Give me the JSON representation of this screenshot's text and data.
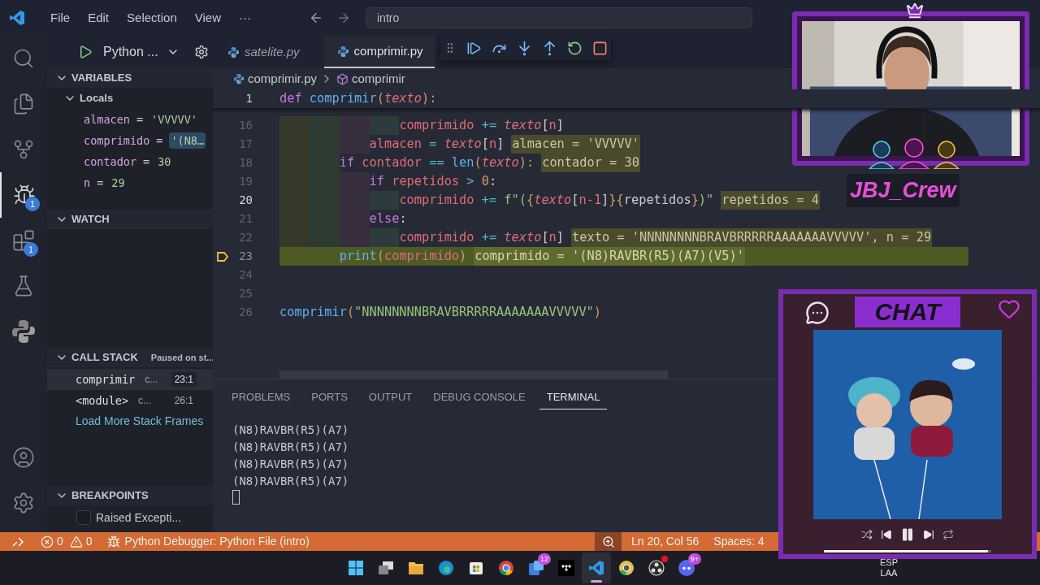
{
  "menu": [
    "File",
    "Edit",
    "Selection",
    "View",
    "···"
  ],
  "search": {
    "value": "intro"
  },
  "activity_bar": [
    {
      "kind": "search",
      "selected": false
    },
    {
      "kind": "files",
      "selected": false
    },
    {
      "kind": "source-control",
      "selected": false
    },
    {
      "kind": "debug",
      "selected": true,
      "badge": "1"
    },
    {
      "kind": "extensions",
      "selected": false,
      "badge": "1"
    },
    {
      "kind": "testing",
      "selected": false
    },
    {
      "kind": "python",
      "selected": false
    }
  ],
  "activity_bottom": [
    {
      "kind": "account"
    },
    {
      "kind": "settings"
    }
  ],
  "run_bar": {
    "config": "Python ..."
  },
  "variables": {
    "title": "VARIABLES",
    "expanded": true,
    "scopes": [
      {
        "label": "Locals",
        "expanded": true,
        "children": [
          {
            "name": "almacen",
            "op": "=",
            "value": "'VVVVV'",
            "selected": false
          },
          {
            "name": "comprimido",
            "op": "=",
            "value": "'(N8…",
            "selected": true
          },
          {
            "name": "contador",
            "op": "=",
            "value": "30",
            "selected": false
          },
          {
            "name": "n",
            "op": "=",
            "value": "29",
            "selected": false
          }
        ]
      }
    ]
  },
  "watch": {
    "title": "WATCH",
    "expanded": true
  },
  "call_stack": {
    "title": "CALL STACK",
    "expanded": true,
    "status": "Paused on st...",
    "frames": [
      {
        "name": "comprimir",
        "file": "c...",
        "position": "23:1",
        "selected": true
      },
      {
        "name": "<module>",
        "file": "c...",
        "position": "26:1",
        "selected": false
      }
    ],
    "load_more": "Load More Stack Frames"
  },
  "breakpoints": {
    "title": "BREAKPOINTS",
    "expanded": true,
    "items": [
      {
        "label": "Raised Excepti...",
        "checked": false
      }
    ]
  },
  "tabs": [
    {
      "label": "satelite.py",
      "selected": false,
      "preview": true
    },
    {
      "label": "comprimir.py",
      "selected": true,
      "preview": false
    }
  ],
  "debug_toolbar": [
    {
      "kind": "continue"
    },
    {
      "kind": "step-over"
    },
    {
      "kind": "step-into"
    },
    {
      "kind": "step-out"
    },
    {
      "kind": "restart"
    },
    {
      "kind": "stop"
    }
  ],
  "breadcrumbs": [
    {
      "label": "comprimir.py",
      "kind": "file"
    },
    {
      "label": "comprimir",
      "kind": "symbol"
    }
  ],
  "sticky_line": {
    "number": "1",
    "tokens": [
      {
        "t": "def ",
        "kind": "kw"
      },
      {
        "t": "comprimir",
        "kind": "fn"
      },
      {
        "t": "(",
        "kind": "punc"
      },
      {
        "t": "texto",
        "kind": "param"
      },
      {
        "t": "):",
        "kind": "punc"
      }
    ]
  },
  "code": [
    {
      "number": "16",
      "current": false,
      "tokens": [
        {
          "t": "                comprimido ",
          "kind": "var"
        },
        {
          "t": "+= ",
          "kind": "op"
        },
        {
          "t": "texto",
          "kind": "param"
        },
        {
          "t": "[",
          "kind": "plain"
        },
        {
          "t": "n",
          "kind": "var"
        },
        {
          "t": "]",
          "kind": "plain"
        }
      ]
    },
    {
      "number": "17",
      "current": false,
      "tokens": [
        {
          "t": "            almacen ",
          "kind": "var"
        },
        {
          "t": "= ",
          "kind": "op"
        },
        {
          "t": "texto",
          "kind": "param"
        },
        {
          "t": "[",
          "kind": "plain"
        },
        {
          "t": "n",
          "kind": "var"
        },
        {
          "t": "]",
          "kind": "plain"
        }
      ],
      "inline_value": "almacen = 'VVVVV'"
    },
    {
      "number": "18",
      "current": false,
      "tokens": [
        {
          "t": "        if ",
          "kind": "kw"
        },
        {
          "t": "contador ",
          "kind": "var"
        },
        {
          "t": "== ",
          "kind": "op"
        },
        {
          "t": "len",
          "kind": "fn"
        },
        {
          "t": "(",
          "kind": "punc"
        },
        {
          "t": "texto",
          "kind": "param"
        },
        {
          "t": "):",
          "kind": "punc"
        }
      ],
      "inline_value": "contador = 30"
    },
    {
      "number": "19",
      "current": false,
      "tokens": [
        {
          "t": "            if ",
          "kind": "kw"
        },
        {
          "t": "repetidos ",
          "kind": "var"
        },
        {
          "t": "> ",
          "kind": "op"
        },
        {
          "t": "0",
          "kind": "num"
        },
        {
          "t": ":",
          "kind": "plain"
        }
      ]
    },
    {
      "number": "20",
      "current": false,
      "active": true,
      "tokens": [
        {
          "t": "                comprimido ",
          "kind": "var"
        },
        {
          "t": "+= ",
          "kind": "op"
        },
        {
          "t": "f\"(",
          "kind": "str"
        },
        {
          "t": "{",
          "kind": "punc"
        },
        {
          "t": "texto",
          "kind": "param"
        },
        {
          "t": "[",
          "kind": "plain"
        },
        {
          "t": "n-1",
          "kind": "var"
        },
        {
          "t": "]",
          "kind": "plain"
        },
        {
          "t": "}{",
          "kind": "punc"
        },
        {
          "t": "repetidos",
          "kind": "plain"
        },
        {
          "t": "}",
          "kind": "punc"
        },
        {
          "t": ")\"",
          "kind": "str"
        }
      ],
      "inline_value": "repetidos = 4"
    },
    {
      "number": "21",
      "current": false,
      "tokens": [
        {
          "t": "            else",
          "kind": "kw"
        },
        {
          "t": ":",
          "kind": "plain"
        }
      ]
    },
    {
      "number": "22",
      "current": false,
      "tokens": [
        {
          "t": "                comprimido ",
          "kind": "var"
        },
        {
          "t": "+= ",
          "kind": "op"
        },
        {
          "t": "texto",
          "kind": "param"
        },
        {
          "t": "[",
          "kind": "plain"
        },
        {
          "t": "n",
          "kind": "var"
        },
        {
          "t": "]",
          "kind": "plain"
        }
      ],
      "inline_value": "texto = 'NNNNNNNNBRAVBRRRRRAAAAAAAVVVVV', n = 29"
    },
    {
      "number": "23",
      "current": true,
      "tokens": [
        {
          "t": "        print",
          "kind": "fn"
        },
        {
          "t": "(",
          "kind": "punc"
        },
        {
          "t": "comprimido",
          "kind": "var"
        },
        {
          "t": ")",
          "kind": "punc"
        }
      ],
      "inline_value": "comprimido = '(N8)RAVBR(R5)(A7)(V5)'"
    },
    {
      "number": "24",
      "current": false
    },
    {
      "number": "25",
      "current": false
    },
    {
      "number": "26",
      "current": false,
      "tokens": [
        {
          "t": "comprimir",
          "kind": "fn"
        },
        {
          "t": "(",
          "kind": "punc"
        },
        {
          "t": "\"NNNNNNNNBRAVBRRRRRAAAAAAAVVVVV\"",
          "kind": "str"
        },
        {
          "t": ")",
          "kind": "punc"
        }
      ]
    }
  ],
  "panel_tabs": [
    {
      "label": "PROBLEMS",
      "selected": false
    },
    {
      "label": "PORTS",
      "selected": false
    },
    {
      "label": "OUTPUT",
      "selected": false
    },
    {
      "label": "DEBUG CONSOLE",
      "selected": false
    },
    {
      "label": "TERMINAL",
      "selected": true
    }
  ],
  "terminal": [
    "(N8)RAVBR(R5)(A7)",
    "(N8)RAVBR(R5)(A7)",
    "(N8)RAVBR(R5)(A7)",
    "(N8)RAVBR(R5)(A7)"
  ],
  "status_bar": {
    "errors": "0",
    "warnings": "0",
    "debug": "Python Debugger: Python File (intro)",
    "position": "Ln 20, Col 56",
    "spaces": "Spaces: 4"
  },
  "taskbar": [
    {
      "kind": "windows"
    },
    {
      "kind": "task-view"
    },
    {
      "kind": "folder"
    },
    {
      "kind": "edge"
    },
    {
      "kind": "store"
    },
    {
      "kind": "chrome"
    },
    {
      "kind": "teams",
      "badge": "12"
    },
    {
      "kind": "tidal"
    },
    {
      "kind": "vscode",
      "selected": true
    },
    {
      "kind": "chrome-dev"
    },
    {
      "kind": "obs",
      "dot": true
    },
    {
      "kind": "discord",
      "badge": "9+"
    }
  ],
  "language": [
    "ESP",
    "LAA"
  ],
  "overlay": {
    "logo": "JBJ_Crew",
    "chat": {
      "title": "CHAT",
      "player": {
        "level": 0.98
      }
    }
  }
}
